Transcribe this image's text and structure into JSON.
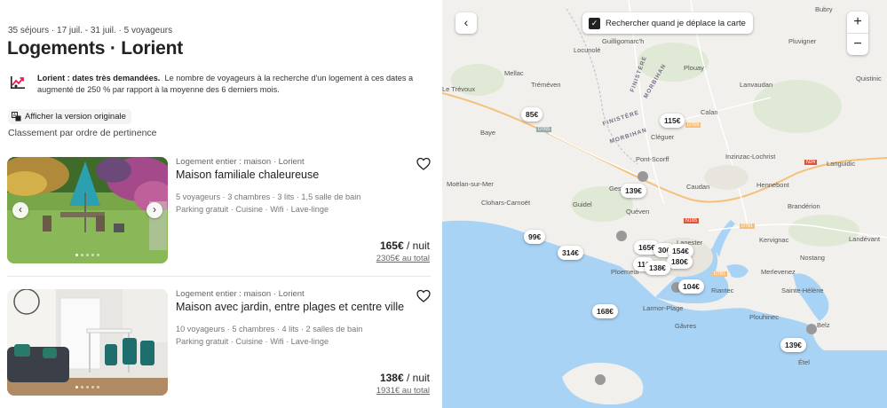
{
  "search": {
    "summary": "35 séjours · 17 juil. - 31 juil. · 5 voyageurs",
    "title": "Logements · Lorient",
    "alert_bold": "Lorient : dates très demandées.",
    "alert_text": "Le nombre de voyageurs à la recherche d'un logement à ces dates a augmenté de 250 % par rapport à la moyenne des 6 derniers mois.",
    "translate_label": "Afficher la version originale",
    "sort_label": "Classement par ordre de pertinence"
  },
  "listings": [
    {
      "type": "Logement entier : maison · Lorient",
      "name": "Maison familiale chaleureuse",
      "amenities_1": "5 voyageurs · 3 chambres · 3 lits · 1,5 salle de bain",
      "amenities_2": "Parking gratuit · Cuisine · Wifi · Lave-linge",
      "price": "165€",
      "price_unit": " / nuit",
      "total": "2305€ au total"
    },
    {
      "type": "Logement entier : maison · Lorient",
      "name": "Maison avec jardin, entre plages et centre ville",
      "amenities_1": "10 voyageurs · 5 chambres · 4 lits · 2 salles de bain",
      "amenities_2": "Parking gratuit · Cuisine · Wifi · Lave-linge",
      "price": "138€",
      "price_unit": " / nuit",
      "total": "1931€ au total"
    }
  ],
  "map": {
    "search_as_move": "Rechercher quand je déplace la carte",
    "checked": true,
    "places": [
      "Bubry",
      "Quistinic",
      "Locunolé",
      "Guilligomarc'h",
      "Pluvigner",
      "Mellac",
      "Tréméven",
      "Plouay",
      "Le Trévoux",
      "Lanvaudan",
      "Calan",
      "Baye",
      "Cléguer",
      "Inzinzac-Lochrist",
      "Languidic",
      "Pont-Scorff",
      "Moëlan-sur-Mer",
      "Gestel",
      "Caudan",
      "Hennebont",
      "Clohars-Carnoët",
      "Guidel",
      "Quéven",
      "Brandérion",
      "Lanester",
      "Kervignac",
      "Landévant",
      "Ploemeur",
      "Nostang",
      "Merlevenez",
      "Larmor-Plage",
      "Riantec",
      "Sainte-Hélène",
      "Gâvres",
      "Plouhinec",
      "Belz",
      "Étel",
      "FINISTÈRE",
      "MORBIHAN",
      "FINISTÈRE",
      "MORBIHAN"
    ],
    "roads": [
      "D769",
      "D765",
      "N24",
      "N165",
      "D781",
      "D781"
    ],
    "price_pins": [
      "85€",
      "115€",
      "139€",
      "99€",
      "314€",
      "165€",
      "30€",
      "154€",
      "180€",
      "11€",
      "138€",
      "104€",
      "168€",
      "139€"
    ]
  },
  "colors": {
    "sea": "#a9d3f5",
    "land": "#f2f0ec",
    "forest": "#dfe9d5",
    "accent": "#222222"
  }
}
